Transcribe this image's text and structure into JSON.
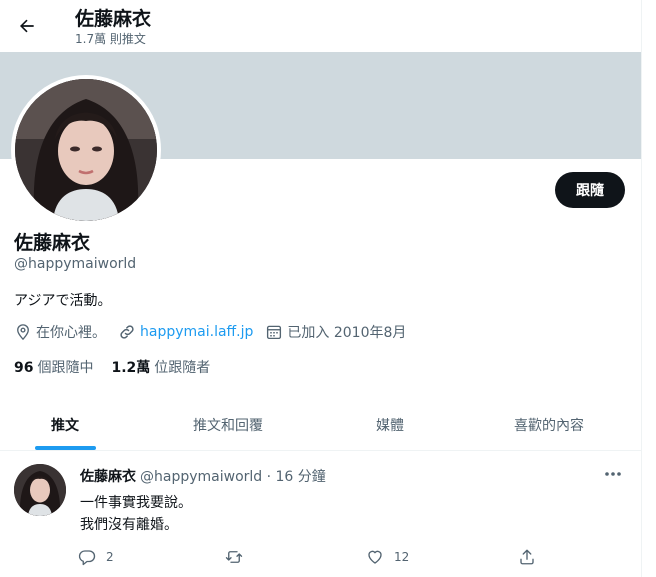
{
  "header": {
    "name": "佐藤麻衣",
    "tweet_count": "1.7萬 則推文",
    "back_icon": "arrow-left-icon"
  },
  "profile": {
    "name": "佐藤麻衣",
    "handle": "@happymaiworld",
    "bio": "アジアで活動。",
    "location": "在你心裡。",
    "website": "happymai.laff.jp",
    "joined": "已加入 2010年8月",
    "follow_button": "跟隨",
    "following_count": "96",
    "following_label": "個跟隨中",
    "followers_count": "1.2萬",
    "followers_label": "位跟隨者"
  },
  "tabs": [
    {
      "label": "推文",
      "active": true
    },
    {
      "label": "推文和回覆",
      "active": false
    },
    {
      "label": "媒體",
      "active": false
    },
    {
      "label": "喜歡的內容",
      "active": false
    }
  ],
  "tweet": {
    "author": "佐藤麻衣",
    "meta": "@happymaiworld · 16 分鐘",
    "lines": [
      "一件事實我要說。",
      "我們沒有離婚。"
    ],
    "replies": "2",
    "retweets": "",
    "likes": "12"
  },
  "colors": {
    "accent": "#1d9bf0",
    "banner": "#cfd9de",
    "text_secondary": "#536471",
    "button_bg": "#0f1419"
  }
}
